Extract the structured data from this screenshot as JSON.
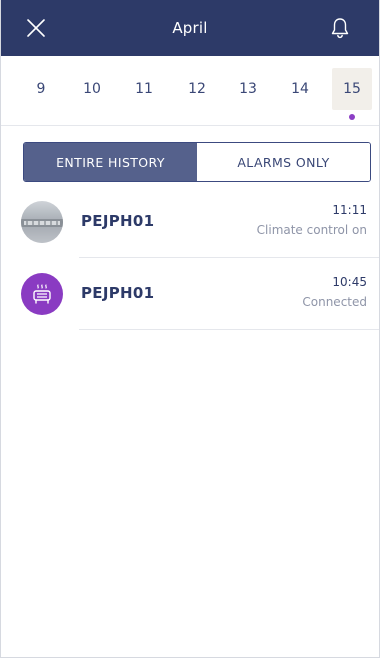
{
  "header": {
    "title": "April",
    "close_icon": "close-icon",
    "bell_icon": "bell-icon"
  },
  "dates": {
    "days": [
      "9",
      "10",
      "11",
      "12",
      "13",
      "14",
      "15"
    ],
    "selected": "15",
    "marker_color": "#8c3ec5"
  },
  "filter": {
    "entire_history_label": "ENTIRE HISTORY",
    "alarms_only_label": "ALARMS ONLY",
    "active": "ENTIRE HISTORY"
  },
  "history": {
    "items": [
      {
        "device": "PEJPH01",
        "time": "11:11",
        "status": "Climate control on",
        "avatar": "device-photo"
      },
      {
        "device": "PEJPH01",
        "time": "10:45",
        "status": "Connected",
        "avatar": "heater-icon"
      }
    ]
  },
  "colors": {
    "header_bg": "#2d3a68",
    "segment_active": "#55618c",
    "accent_purple": "#8a3bc2",
    "text_primary": "#2d3a68",
    "text_secondary": "#8f95a8"
  }
}
